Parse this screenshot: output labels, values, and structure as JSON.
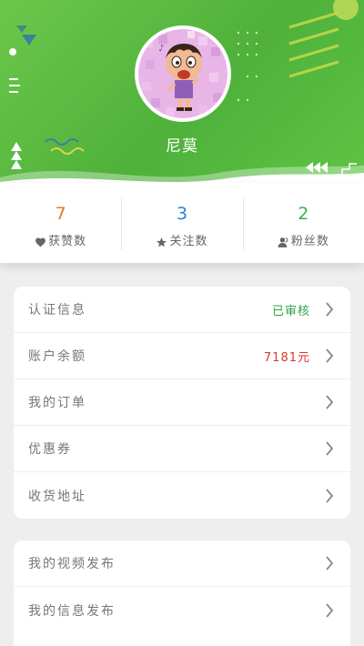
{
  "profile": {
    "username": "尼莫"
  },
  "stats": [
    {
      "value": "7",
      "label": "获赞数",
      "icon": "heart-icon",
      "color": "#e07a2a"
    },
    {
      "value": "3",
      "label": "关注数",
      "icon": "star-icon",
      "color": "#2a83d6"
    },
    {
      "value": "2",
      "label": "粉丝数",
      "icon": "person-icon",
      "color": "#3fae4a"
    }
  ],
  "menu_group_1": [
    {
      "label": "认证信息",
      "value": "已审核",
      "value_color": "#2fa347"
    },
    {
      "label": "账户余额",
      "value": "7181元",
      "value_color": "#d93a2b"
    },
    {
      "label": "我的订单",
      "value": ""
    },
    {
      "label": "优惠券",
      "value": ""
    },
    {
      "label": "收货地址",
      "value": ""
    }
  ],
  "menu_group_2": [
    {
      "label": "我的视频发布",
      "value": ""
    },
    {
      "label": "我的信息发布",
      "value": ""
    }
  ],
  "colors": {
    "header_green": "#5cbd41",
    "background": "#eeeeee",
    "chevron": "#888888"
  }
}
